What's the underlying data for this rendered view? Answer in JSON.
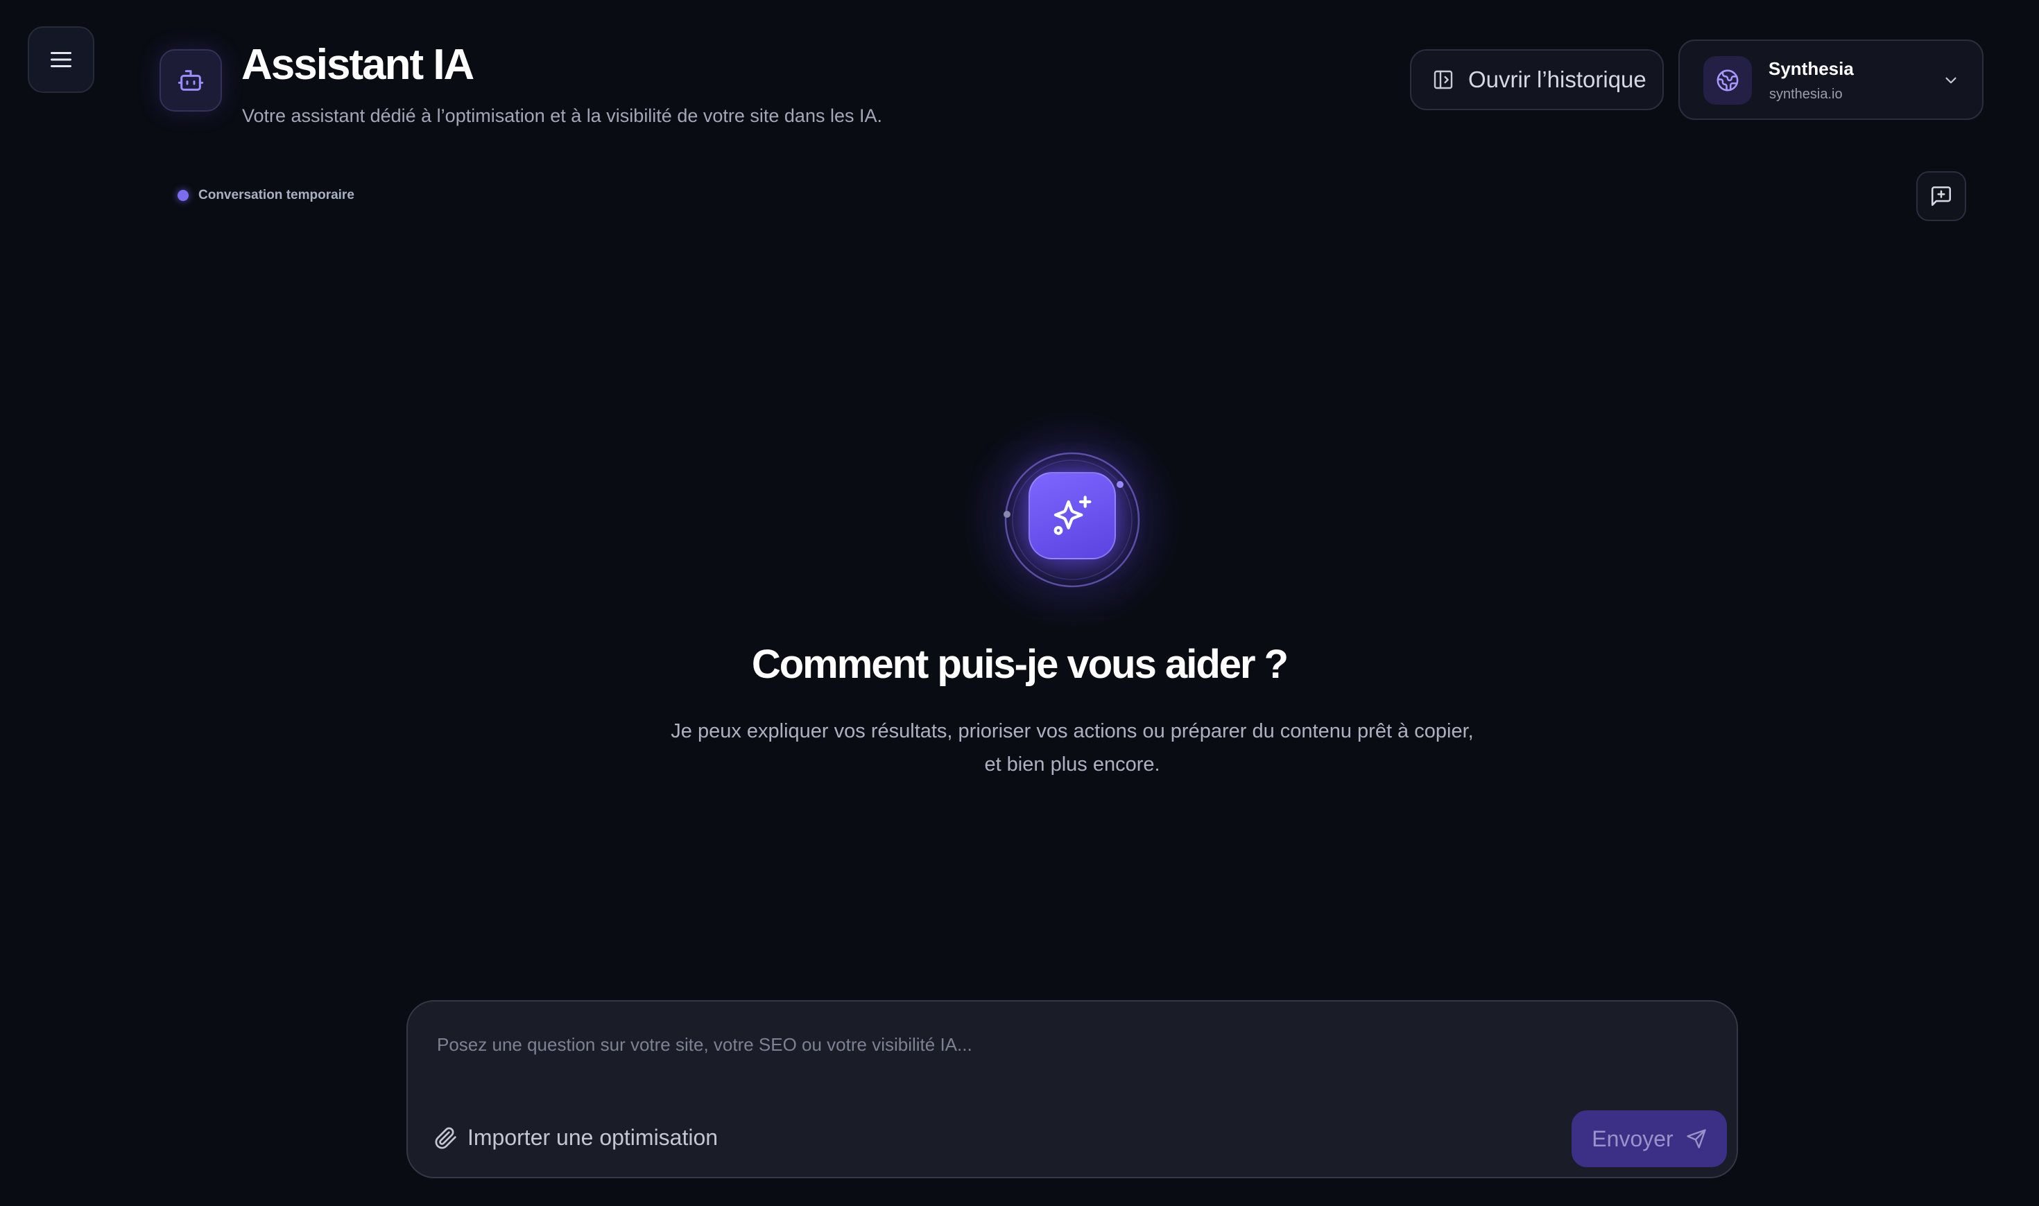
{
  "app": {
    "title": "Assistant IA",
    "subtitle": "Votre assistant dédié à l’optimisation et à la visibilité de votre site dans les IA."
  },
  "header": {
    "menu_icon": "hamburger-menu-icon",
    "bot_icon": "robot-icon",
    "history_button": {
      "label": "Ouvrir l’historique",
      "icon": "sidebar-panel-icon"
    },
    "site_selector": {
      "name": "Synthesia",
      "domain": "synthesia.io",
      "icon": "globe-icon",
      "chevron": "chevron-down-icon"
    }
  },
  "conversation": {
    "status_label": "Conversation temporaire",
    "status_color": "#7c6cf0",
    "new_chat_icon": "new-message-icon"
  },
  "hero": {
    "icon": "sparkles-icon",
    "title": "Comment puis-je vous aider ?",
    "description": "Je peux expliquer vos résultats, prioriser vos actions ou préparer du contenu prêt à copier, et bien plus encore."
  },
  "composer": {
    "placeholder": "Posez une question sur votre site, votre SEO ou votre visibilité IA...",
    "value": "",
    "import_label": "Importer une optimisation",
    "import_icon": "paperclip-icon",
    "send_label": "Envoyer",
    "send_icon": "send-icon"
  },
  "colors": {
    "background": "#0a0c14",
    "accent": "#6c54ff",
    "send_button": "#3b2f86",
    "panel": "#12141f"
  }
}
